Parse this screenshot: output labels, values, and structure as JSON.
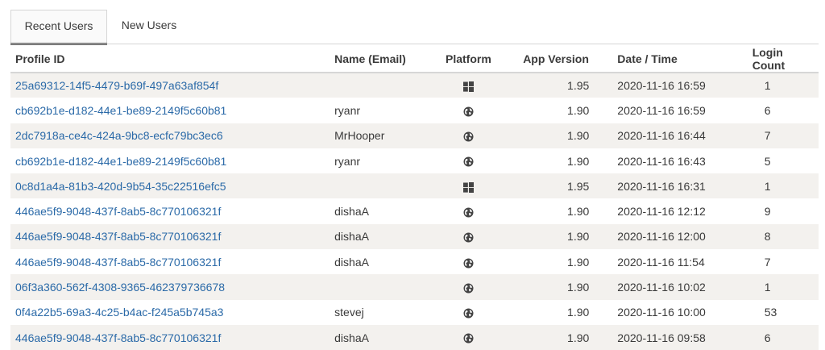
{
  "tabs": [
    {
      "label": "Recent Users",
      "active": true
    },
    {
      "label": "New Users",
      "active": false
    }
  ],
  "columns": {
    "profile_id": "Profile ID",
    "name": "Name (Email)",
    "platform": "Platform",
    "app_version": "App Version",
    "date_time": "Date / Time",
    "login_count": "Login Count"
  },
  "rows": [
    {
      "profile_id": "25a69312-14f5-4479-b69f-497a63af854f",
      "name": "",
      "platform": "windows-icon",
      "app_version": "1.95",
      "date_time": "2020-11-16 16:59",
      "login_count": "1"
    },
    {
      "profile_id": "cb692b1e-d182-44e1-be89-2149f5c60b81",
      "name": "ryanr",
      "platform": "globe-icon",
      "app_version": "1.90",
      "date_time": "2020-11-16 16:59",
      "login_count": "6"
    },
    {
      "profile_id": "2dc7918a-ce4c-424a-9bc8-ecfc79bc3ec6",
      "name": "MrHooper",
      "platform": "globe-icon",
      "app_version": "1.90",
      "date_time": "2020-11-16 16:44",
      "login_count": "7"
    },
    {
      "profile_id": "cb692b1e-d182-44e1-be89-2149f5c60b81",
      "name": "ryanr",
      "platform": "globe-icon",
      "app_version": "1.90",
      "date_time": "2020-11-16 16:43",
      "login_count": "5"
    },
    {
      "profile_id": "0c8d1a4a-81b3-420d-9b54-35c22516efc5",
      "name": "",
      "platform": "windows-icon",
      "app_version": "1.95",
      "date_time": "2020-11-16 16:31",
      "login_count": "1"
    },
    {
      "profile_id": "446ae5f9-9048-437f-8ab5-8c770106321f",
      "name": "dishaA",
      "platform": "globe-icon",
      "app_version": "1.90",
      "date_time": "2020-11-16 12:12",
      "login_count": "9"
    },
    {
      "profile_id": "446ae5f9-9048-437f-8ab5-8c770106321f",
      "name": "dishaA",
      "platform": "globe-icon",
      "app_version": "1.90",
      "date_time": "2020-11-16 12:00",
      "login_count": "8"
    },
    {
      "profile_id": "446ae5f9-9048-437f-8ab5-8c770106321f",
      "name": "dishaA",
      "platform": "globe-icon",
      "app_version": "1.90",
      "date_time": "2020-11-16 11:54",
      "login_count": "7"
    },
    {
      "profile_id": "06f3a360-562f-4308-9365-462379736678",
      "name": "",
      "platform": "globe-icon",
      "app_version": "1.90",
      "date_time": "2020-11-16 10:02",
      "login_count": "1"
    },
    {
      "profile_id": "0f4a22b5-69a3-4c25-b4ac-f245a5b745a3",
      "name": "stevej",
      "platform": "globe-icon",
      "app_version": "1.90",
      "date_time": "2020-11-16 10:00",
      "login_count": "53"
    },
    {
      "profile_id": "446ae5f9-9048-437f-8ab5-8c770106321f",
      "name": "dishaA",
      "platform": "globe-icon",
      "app_version": "1.90",
      "date_time": "2020-11-16 09:58",
      "login_count": "6"
    }
  ],
  "colors": {
    "link": "#2b6aa8",
    "row_alt": "#f3f1ee",
    "icon": "#444444"
  }
}
